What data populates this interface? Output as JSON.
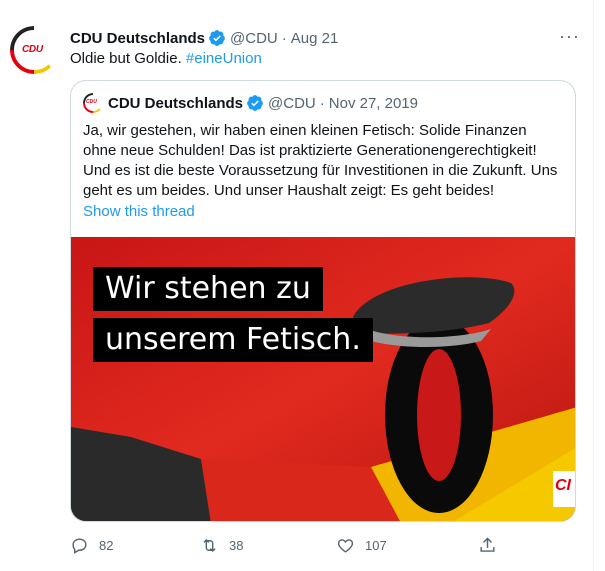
{
  "tweet": {
    "author_name": "CDU Deutschlands",
    "handle": "@CDU",
    "separator": "·",
    "date": "Aug 21",
    "text_plain": "Oldie but Goldie. ",
    "hashtag": "#eineUnion",
    "more_label": "···",
    "avatar_logo": "CDU"
  },
  "quote": {
    "author_name": "CDU Deutschlands",
    "handle": "@CDU",
    "separator": "·",
    "date": "Nov 27, 2019",
    "body": "Ja, wir gestehen, wir haben einen kleinen Fetisch: Solide Finanzen ohne neue Schulden! Das ist praktizierte Generationengerechtigkeit! Und es ist die beste Voraussetzung für Investitionen in die Zukunft. Uns geht es um beides. Und unser Haushalt zeigt: Es geht beides!",
    "show_thread": "Show this thread",
    "avatar_logo": "CDU"
  },
  "image": {
    "caption_line1": "Wir stehen zu",
    "caption_line2": "unserem Fetisch.",
    "big_number": "0",
    "corner_logo": "CI"
  },
  "actions": {
    "replies": "82",
    "retweets": "38",
    "likes": "107"
  },
  "colors": {
    "accent": "#1d9bf0",
    "cdu_red": "#e3000f",
    "text_secondary": "#536471"
  }
}
